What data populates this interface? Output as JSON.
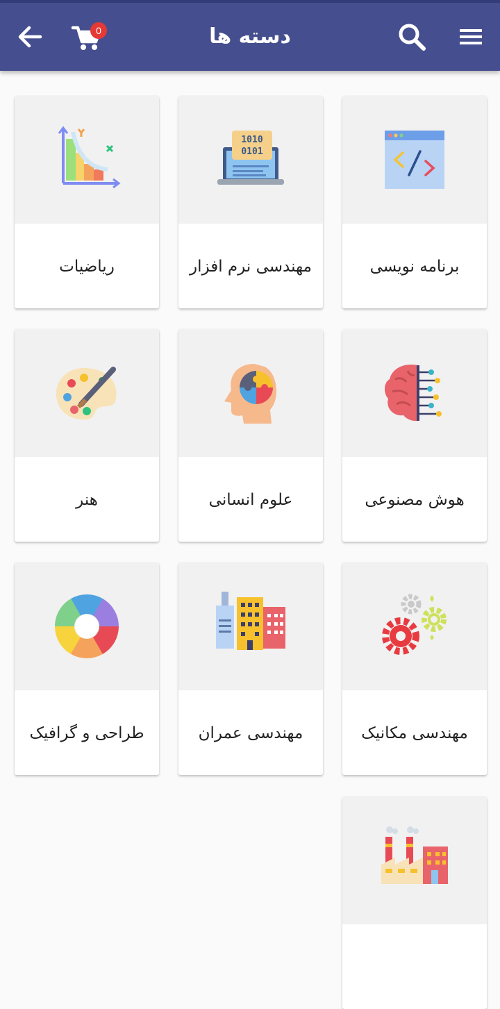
{
  "header": {
    "title": "دسته ها",
    "cart_count": "0",
    "colors": {
      "appbar": "#454f8f",
      "badge": "#e53935"
    }
  },
  "categories": [
    {
      "label": "برنامه نویسی",
      "icon": "code-window-icon"
    },
    {
      "label": "مهندسی نرم افزار",
      "icon": "laptop-binary-icon"
    },
    {
      "label": "ریاضیات",
      "icon": "math-graph-icon"
    },
    {
      "label": "هوش مصنوعی",
      "icon": "ai-brain-icon"
    },
    {
      "label": "علوم انسانی",
      "icon": "head-puzzle-icon"
    },
    {
      "label": "هنر",
      "icon": "paint-palette-icon"
    },
    {
      "label": "مهندسی مکانیک",
      "icon": "gears-icon"
    },
    {
      "label": "مهندسی عمران",
      "icon": "buildings-icon"
    },
    {
      "label": "طراحی و گرافیک",
      "icon": "color-wheel-icon"
    },
    {
      "icon": "factory-icon"
    }
  ]
}
